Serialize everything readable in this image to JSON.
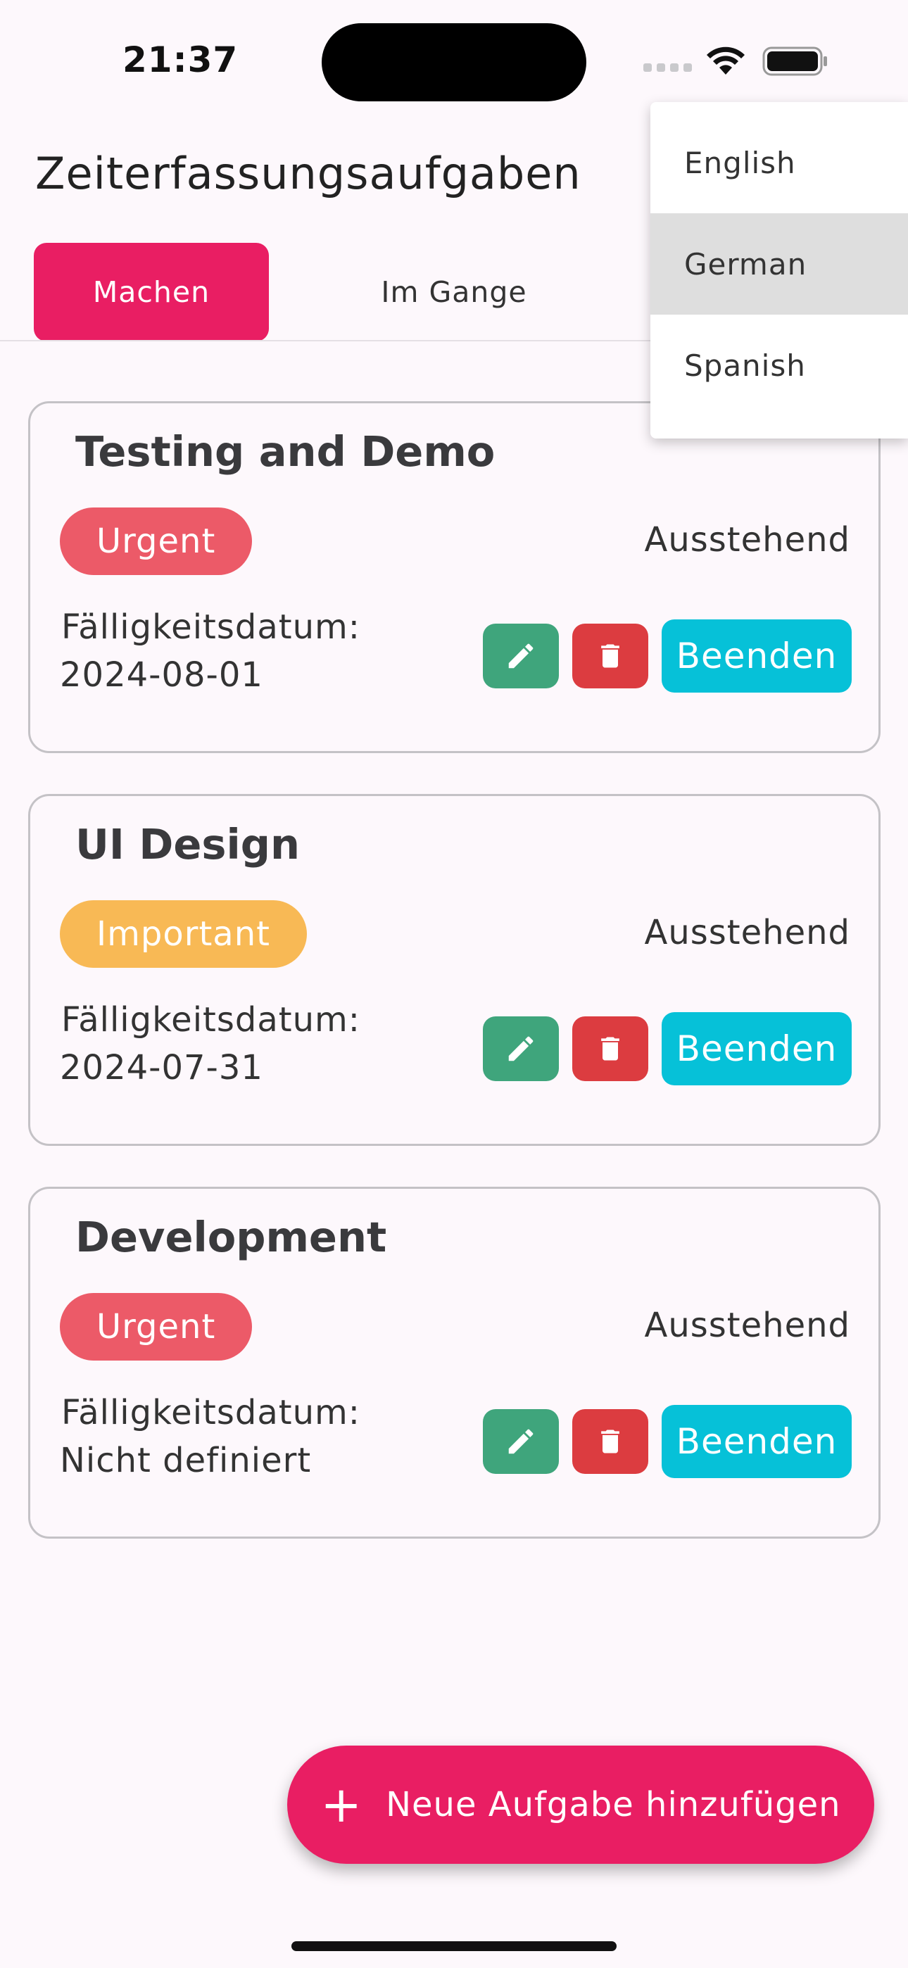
{
  "status_bar": {
    "time": "21:37"
  },
  "app": {
    "title": "Zeiterfassungsaufgaben"
  },
  "tabs": [
    {
      "label": "Machen",
      "active": true
    },
    {
      "label": "Im Gange",
      "active": false
    }
  ],
  "tasks": [
    {
      "title": "Testing and Demo",
      "priority": "Urgent",
      "status": "Ausstehend",
      "due_label": "Fälligkeitsdatum:",
      "due_value": "2024-08-01",
      "finish_label": "Beenden"
    },
    {
      "title": "UI Design",
      "priority": "Important",
      "status": "Ausstehend",
      "due_label": "Fälligkeitsdatum:",
      "due_value": "2024-07-31",
      "finish_label": "Beenden"
    },
    {
      "title": "Development",
      "priority": "Urgent",
      "status": "Ausstehend",
      "due_label": "Fälligkeitsdatum:",
      "due_value": "Nicht definiert",
      "finish_label": "Beenden"
    }
  ],
  "fab": {
    "label": "Neue Aufgabe hinzufügen",
    "icon": "plus-icon"
  },
  "language_menu": {
    "items": [
      "English",
      "German",
      "Spanish"
    ],
    "selected": "German"
  },
  "colors": {
    "accent": "#e91e63",
    "urgent": "#ec5a68",
    "important": "#f8b955",
    "edit": "#3fa57c",
    "delete": "#dc3c40",
    "finish": "#06c1d8"
  }
}
